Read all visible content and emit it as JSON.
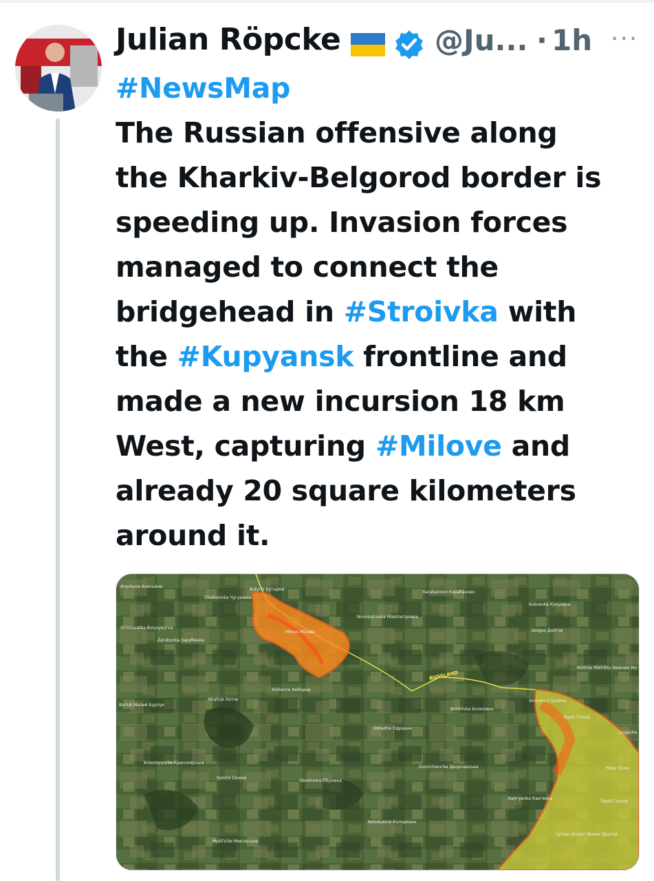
{
  "author": {
    "name": "Julian Röpcke",
    "flag": "ukraine-flag",
    "verified": true,
    "handle": "@Ju...",
    "separator": "·",
    "time": "1h",
    "more": "···"
  },
  "tweet": {
    "lines": [
      [
        {
          "t": "#NewsMap",
          "tag": true
        }
      ],
      [
        {
          "t": "The Russian offensive along",
          "tag": false
        }
      ],
      [
        {
          "t": "the Kharkiv-Belgorod border is",
          "tag": false
        }
      ],
      [
        {
          "t": "speeding up. Invasion forces",
          "tag": false
        }
      ],
      [
        {
          "t": "managed to connect the",
          "tag": false
        }
      ],
      [
        {
          "t": "bridgehead in ",
          "tag": false
        },
        {
          "t": "#Stroivka",
          "tag": true
        },
        {
          "t": " with",
          "tag": false
        }
      ],
      [
        {
          "t": "the ",
          "tag": false
        },
        {
          "t": "#Kupyansk",
          "tag": true
        },
        {
          "t": " frontline and",
          "tag": false
        }
      ],
      [
        {
          "t": "made a new incursion 18 km",
          "tag": false
        }
      ],
      [
        {
          "t": "West, capturing ",
          "tag": false
        },
        {
          "t": "#Milove",
          "tag": true
        },
        {
          "t": " and",
          "tag": false
        }
      ],
      [
        {
          "t": "already 20 square kilometers",
          "tag": false
        }
      ],
      [
        {
          "t": "around it.",
          "tag": false
        }
      ]
    ]
  },
  "map": {
    "labels": [
      "Anyskyne Анисьине",
      "Chuhunivka Чугунівка",
      "Butyrki Бутырки",
      "Karabanovo Карабаново",
      "Kukuevka Кукуевка",
      "Vil'khuvatka Вільхуватка",
      "Milove Мілове",
      "Novopetrovka Новопетровка",
      "Dolgoe Долгое",
      "Zarubynka Зарубинка",
      "Nizhnie Melnitsy Нижние Ме",
      "RUSSLAND",
      "Ambarne Амбарне",
      "Khatnje Хатнє",
      "Stroivka Строївка",
      "Burluk Малий Бурлук",
      "Bolohivka Болохівка",
      "Topoli Тополі",
      "Logache",
      "Odradne Одрадне",
      "Krasnoyars'ke Красноярське",
      "Dvorichans'ke Дворічанське",
      "Pisky Піски",
      "Sonino Соніно",
      "Obukhivka Обухівка",
      "Kam'yanka Кам'янка",
      "Topoli Тополі",
      "Kolodyazne Колодязне",
      "Lyman Druhyi Лиман Другий",
      "Mykil's'ke Микільське"
    ]
  },
  "colors": {
    "link": "#1d9bf0",
    "text": "#0f1419",
    "muted": "#536471",
    "frontline_ru": "#ff6a00",
    "border_line": "#e8e04a"
  }
}
